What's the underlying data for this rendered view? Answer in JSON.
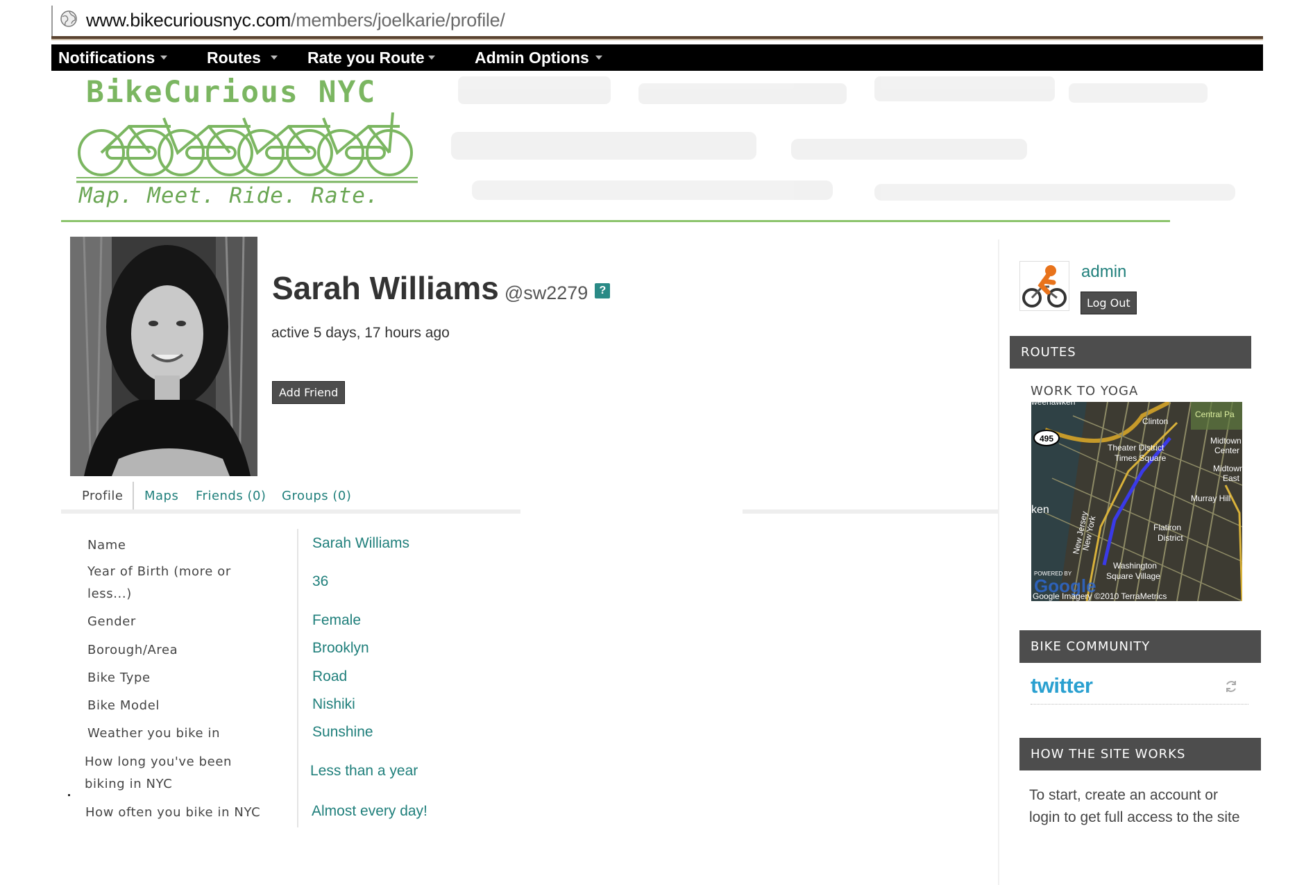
{
  "browser": {
    "url_host": "www.bikecuriousnyc.com",
    "url_path": "/members/joelkarie/profile/"
  },
  "nav": {
    "items": [
      {
        "label": "Notifications"
      },
      {
        "label": "Routes"
      },
      {
        "label": "Rate you Route"
      },
      {
        "label": "Admin Options"
      }
    ]
  },
  "banner": {
    "title": "BikeCurious NYC",
    "tagline": "Map. Meet. Ride. Rate."
  },
  "profile": {
    "name": "Sarah Williams",
    "handle": "@sw2279",
    "help_badge": "?",
    "last_active": "active 5 days, 17 hours ago",
    "add_friend_label": "Add Friend"
  },
  "tabs": [
    {
      "label": "Profile",
      "active": true
    },
    {
      "label": "Maps",
      "active": false
    },
    {
      "label": "Friends (0)",
      "active": false
    },
    {
      "label": "Groups (0)",
      "active": false
    }
  ],
  "fields": [
    {
      "label": "Name",
      "value": "Sarah Williams"
    },
    {
      "label": "Year of Birth (more or less...)",
      "value": "36"
    },
    {
      "label": "Gender",
      "value": "Female"
    },
    {
      "label": "Borough/Area",
      "value": "Brooklyn"
    },
    {
      "label": "Bike Type",
      "value": "Road"
    },
    {
      "label": "Bike Model",
      "value": "Nishiki"
    },
    {
      "label": "Weather you bike in",
      "value": "Sunshine"
    },
    {
      "label": "How long you've been biking in NYC",
      "value": "Less than a year"
    },
    {
      "label": "How often you bike in NYC",
      "value": "Almost every day!"
    }
  ],
  "sidebar": {
    "user": "admin",
    "logout_label": "Log Out",
    "routes_heading": "ROUTES",
    "route_title": "WORK TO YOGA",
    "map_labels": {
      "highway": "495",
      "weehawken": "weehawken",
      "central_park": "Central Pa",
      "clinton": "Clinton",
      "theater": "Theater District",
      "times_square": "Times Square",
      "midtown_center_1": "Midtown",
      "midtown_center_2": "Center",
      "midtown_east_1": "Midtown",
      "midtown_east_2": "East",
      "murray_hill": "Murray Hill",
      "ken": "ken",
      "new_jersey": "New Jersey",
      "new_york": "New York",
      "flatiron_1": "Flatiron",
      "flatiron_2": "District",
      "washington_1": "Washington",
      "washington_2": "Square Village",
      "powered_by": "POWERED BY",
      "google_logo": "Google",
      "attribution": "Google  Imagery ©2010 TerraMetrics"
    },
    "community_heading": "BIKE COMMUNITY",
    "twitter_logo": "twitter",
    "howto_heading": "HOW THE SITE WORKS",
    "howto_text": "To start, create an account or login to get full access to the site"
  },
  "colors": {
    "link": "#1f7f7b",
    "brand_green": "#7bb661",
    "nav_bg": "#000000",
    "widget_head_bg": "#4d4d4d",
    "twitter_blue": "#2aa0d0"
  },
  "icons": [
    "globe-icon",
    "dropdown-caret-icon",
    "help-icon",
    "bicycle-rider-icon",
    "refresh-icon"
  ]
}
